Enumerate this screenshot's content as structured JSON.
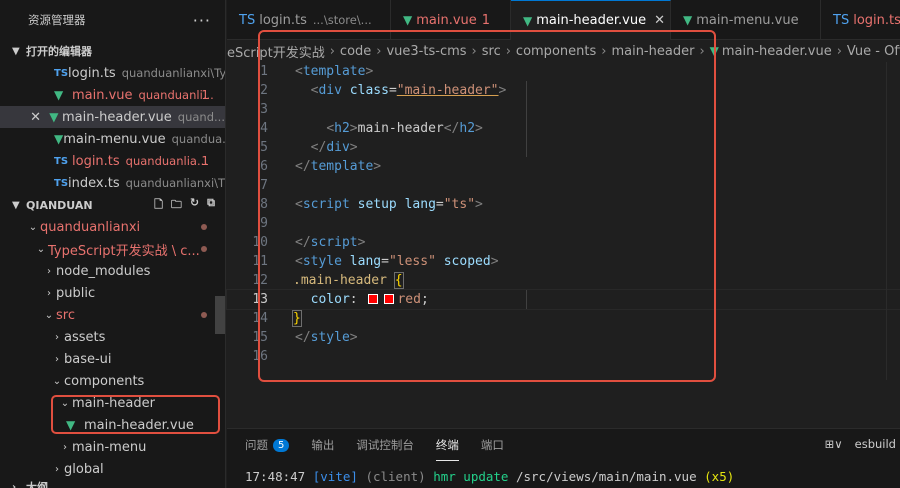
{
  "sidebar": {
    "title": "资源管理器",
    "more": "···",
    "open_editors": {
      "title": "打开的编辑器",
      "items": [
        {
          "type": "TS",
          "name": "login.ts",
          "desc": "quanduanlianxi\\Ty..."
        },
        {
          "type": "VUE",
          "name": "main.vue",
          "desc": "quanduanli...",
          "badge": "1"
        },
        {
          "type": "VUE",
          "name": "main-header.vue",
          "desc": "quand...",
          "close": "✕"
        },
        {
          "type": "VUE",
          "name": "main-menu.vue",
          "desc": "quandua..."
        },
        {
          "type": "TS",
          "name": "login.ts",
          "desc": "quanduanlia...",
          "badge": "1"
        },
        {
          "type": "TS",
          "name": "index.ts",
          "desc": "quanduanlianxi\\T..."
        }
      ]
    },
    "workspace": {
      "title": "QIANDUAN",
      "tree": [
        {
          "label": "quanduanlianxi"
        },
        {
          "label": "TypeScript开发实战 \\ c..."
        },
        {
          "label": "node_modules"
        },
        {
          "label": "public"
        },
        {
          "label": "src"
        },
        {
          "label": "assets"
        },
        {
          "label": "base-ui"
        },
        {
          "label": "components"
        },
        {
          "label": "main-header"
        },
        {
          "label": "main-header.vue"
        },
        {
          "label": "main-menu"
        },
        {
          "label": "global"
        }
      ]
    },
    "outline": {
      "title": "大纲"
    }
  },
  "tabs": [
    {
      "type": "TS",
      "name": "login.ts",
      "desc": "...\\store\\..."
    },
    {
      "type": "VUE",
      "name": "main.vue",
      "num": "1"
    },
    {
      "type": "VUE",
      "name": "main-header.vue",
      "close": "✕"
    },
    {
      "type": "VUE",
      "name": "main-menu.vue"
    },
    {
      "type": "TS",
      "name": "login.ts",
      "desc": "..."
    }
  ],
  "breadcrumb": [
    "eScript开发实战",
    "code",
    "vue3-ts-cms",
    "src",
    "components",
    "main-header",
    "main-header.vue",
    "Vue - Official"
  ],
  "code": {
    "line_numbers": [
      "1",
      "2",
      "3",
      "4",
      "5",
      "6",
      "7",
      "8",
      "9",
      "10",
      "11",
      "12",
      "13",
      "14",
      "15",
      "16"
    ],
    "l1": {
      "lt": "<",
      "tag": "template",
      "gt": ">"
    },
    "l2": {
      "lt": "<",
      "tag": "div",
      "attr": "class",
      "eq": "=",
      "val": "\"main-header\"",
      "gt": ">"
    },
    "l4": {
      "lt": "<",
      "tag": "h2",
      "gt": ">",
      "text": "main-header",
      "clt": "</",
      "ctag": "h2",
      "cgt": ">"
    },
    "l5": {
      "lt": "</",
      "tag": "div",
      "gt": ">"
    },
    "l6": {
      "lt": "</",
      "tag": "template",
      "gt": ">"
    },
    "l8": {
      "lt": "<",
      "tag": "script",
      "attr1": "setup",
      "attr2": "lang",
      "eq": "=",
      "val": "\"ts\"",
      "gt": ">"
    },
    "l10": {
      "lt": "</",
      "tag": "script",
      "gt": ">"
    },
    "l11": {
      "lt": "<",
      "tag": "style",
      "attr1": "lang",
      "eq": "=",
      "val": "\"less\"",
      "attr2": "scoped",
      "gt": ">"
    },
    "l12": {
      "selector": ".main-header",
      "brace": "{"
    },
    "l13": {
      "prop": "color",
      "colon": ":",
      "value": "red",
      "semi": ";"
    },
    "l14": {
      "brace": "}"
    },
    "l15": {
      "lt": "</",
      "tag": "style",
      "gt": ">"
    }
  },
  "panel": {
    "tabs": [
      {
        "label": "问题",
        "badge": "5"
      },
      {
        "label": "输出"
      },
      {
        "label": "调试控制台"
      },
      {
        "label": "终端"
      },
      {
        "label": "端口"
      }
    ],
    "right": {
      "split": "⊞∨",
      "shell": "esbuild"
    },
    "terminal": {
      "time": "17:48:47",
      "vite": "[vite]",
      "client": "(client)",
      "hmr": "hmr update",
      "path": "/src/views/main/main.vue",
      "count": "(x5)"
    }
  },
  "colors": {
    "accent": "#0078d4",
    "highlight": "#e04f3f",
    "vue": "#41b883",
    "ts": "#4fa2ef"
  }
}
